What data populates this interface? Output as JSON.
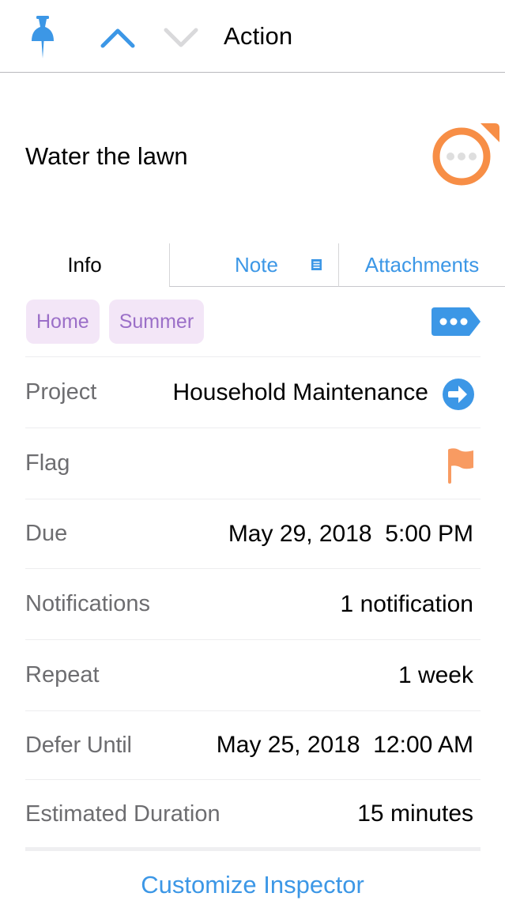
{
  "nav": {
    "title": "Action",
    "icons": {
      "pin": "pin-icon",
      "previous": "chevron-up-icon",
      "next": "chevron-down-icon"
    },
    "colors": {
      "accent": "#3c97e6",
      "disabled": "#d9d9db"
    }
  },
  "task": {
    "title": "Water the lawn",
    "status_icon": "flagged-status-circle-icon",
    "status_color": "#f78e46"
  },
  "tabs": [
    {
      "label": "Info",
      "selected": true
    },
    {
      "label": "Note",
      "icon": "note-lines-icon",
      "selected": false
    },
    {
      "label": "Attachments",
      "selected": false
    }
  ],
  "tags": {
    "items": [
      {
        "label": "Home"
      },
      {
        "label": "Summer"
      }
    ],
    "more_icon": "tag-more-icon",
    "tag_background": "#f3e6f7",
    "tag_text": "#9b6fc8"
  },
  "fields": {
    "project": {
      "label": "Project",
      "value": "Household Maintenance",
      "icon": "arrow-circle-right-icon"
    },
    "flag": {
      "label": "Flag",
      "flagged": true,
      "icon": "flag-icon",
      "color": "#f89b62"
    },
    "due": {
      "label": "Due",
      "value": "May 29, 2018  5:00 PM"
    },
    "notifications": {
      "label": "Notifications",
      "value": "1 notification"
    },
    "repeat": {
      "label": "Repeat",
      "value": "1 week"
    },
    "defer": {
      "label": "Defer Until",
      "value": "May 25, 2018  12:00 AM"
    },
    "estimated": {
      "label": "Estimated Duration",
      "value": "15 minutes"
    }
  },
  "footer": {
    "customize_label": "Customize Inspector"
  }
}
